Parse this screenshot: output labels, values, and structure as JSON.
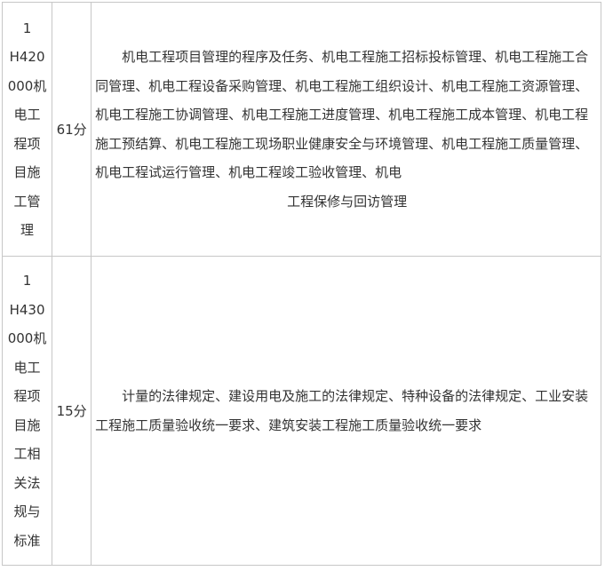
{
  "rows": [
    {
      "code_lines": [
        "1",
        "H420",
        "000机",
        "电工",
        "程项",
        "目施",
        "工管",
        "理"
      ],
      "score": "61分",
      "content_lead": "机电工程项目管理的程序及任务、机电工程施工招标投标管理、机电工程施工合同管理、机电工程设备采购管理、机电工程施工组织设计、机电工程施工资源管理、机电工程施工协调管理、机电工程施工进度管理、机电工程施工成本管理、机电工程施工预结算、机电工程施工现场职业健康安全与环境管理、机电工程施工质量管理、机电工程试运行管理、机电工程竣工验收管理、机电",
      "content_tail": "工程保修与回访管理"
    },
    {
      "code_lines": [
        "1",
        "H430",
        "000机",
        "电工",
        "程项",
        "目施",
        "工相",
        "关法",
        "规与",
        "标准"
      ],
      "score": "15分",
      "content_lead": "计量的法律规定、建设用电及施工的法律规定、特种设备的法律规定、工业安装工程施工质量验收统一要求、建筑安装工程施工质量验收统一要求",
      "content_tail": ""
    }
  ]
}
